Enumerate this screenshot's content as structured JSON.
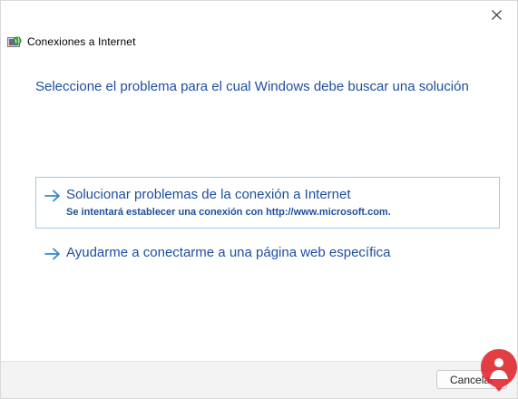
{
  "window": {
    "title": "Conexiones a Internet",
    "close_icon": "close-icon",
    "app_icon": "network-globe-icon"
  },
  "main": {
    "heading": "Seleccione el problema para el cual Windows debe buscar una solución",
    "options": [
      {
        "label": "Solucionar problemas de la conexión a Internet",
        "description": "Se intentará establecer una conexión con http://www.microsoft.com.",
        "icon": "arrow-right-icon",
        "highlighted": true
      },
      {
        "label": "Ayudarme a conectarme a una página web específica",
        "icon": "arrow-right-icon",
        "highlighted": false
      }
    ]
  },
  "footer": {
    "cancel_label": "Cancelar"
  },
  "colors": {
    "link_blue": "#1e4fa0",
    "arrow_blue": "#2a8ad4",
    "highlight_border": "#9ec8e8",
    "footer_bg": "#f3f3f3",
    "watermark_red": "#e0232b"
  }
}
